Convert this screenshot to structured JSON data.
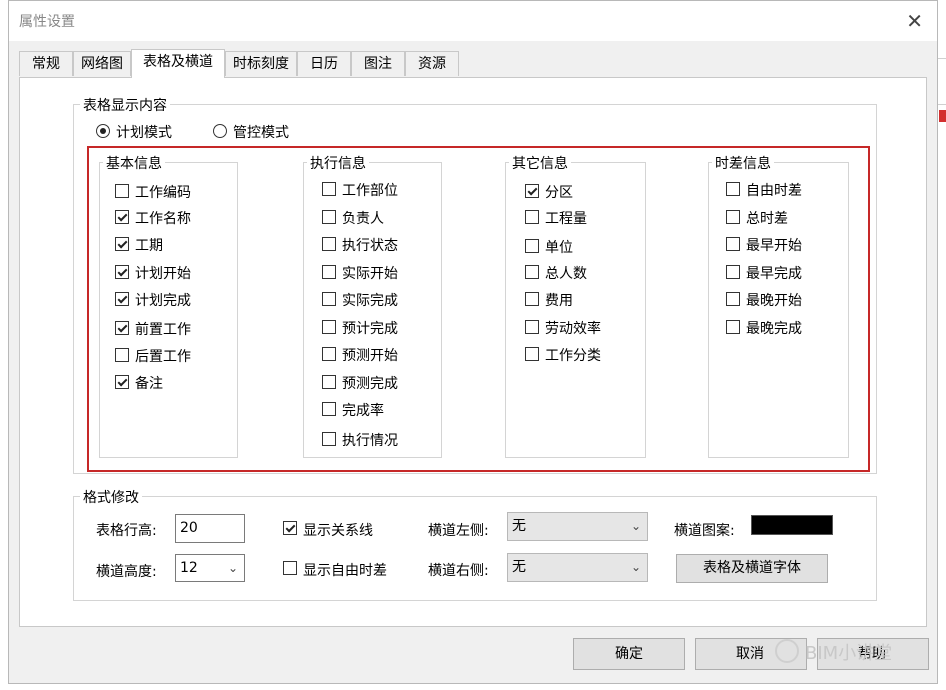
{
  "window": {
    "title": "属性设置",
    "close_symbol": "✕"
  },
  "tabs": [
    {
      "label": "常规"
    },
    {
      "label": "网络图"
    },
    {
      "label": "表格及横道"
    },
    {
      "label": "时标刻度"
    },
    {
      "label": "日历"
    },
    {
      "label": "图注"
    },
    {
      "label": "资源"
    }
  ],
  "table_display": {
    "title": "表格显示内容",
    "modes": [
      {
        "label": "计划模式",
        "selected": true
      },
      {
        "label": "管控模式",
        "selected": false
      }
    ],
    "groups": [
      {
        "title": "基本信息",
        "items": [
          {
            "label": "工作编码",
            "checked": false
          },
          {
            "label": "工作名称",
            "checked": true
          },
          {
            "label": "工期",
            "checked": true
          },
          {
            "label": "计划开始",
            "checked": true
          },
          {
            "label": "计划完成",
            "checked": true
          },
          {
            "label": "前置工作",
            "checked": true
          },
          {
            "label": "后置工作",
            "checked": false
          },
          {
            "label": "备注",
            "checked": true
          }
        ]
      },
      {
        "title": "执行信息",
        "items": [
          {
            "label": "工作部位",
            "checked": false
          },
          {
            "label": "负责人",
            "checked": false
          },
          {
            "label": "执行状态",
            "checked": false
          },
          {
            "label": "实际开始",
            "checked": false
          },
          {
            "label": "实际完成",
            "checked": false
          },
          {
            "label": "预计完成",
            "checked": false
          },
          {
            "label": "预测开始",
            "checked": false
          },
          {
            "label": "预测完成",
            "checked": false
          },
          {
            "label": "完成率",
            "checked": false
          },
          {
            "label": "执行情况",
            "checked": false
          }
        ]
      },
      {
        "title": "其它信息",
        "items": [
          {
            "label": "分区",
            "checked": true
          },
          {
            "label": "工程量",
            "checked": false
          },
          {
            "label": "单位",
            "checked": false
          },
          {
            "label": "总人数",
            "checked": false
          },
          {
            "label": "费用",
            "checked": false
          },
          {
            "label": "劳动效率",
            "checked": false
          },
          {
            "label": "工作分类",
            "checked": false
          }
        ]
      },
      {
        "title": "时差信息",
        "items": [
          {
            "label": "自由时差",
            "checked": false
          },
          {
            "label": "总时差",
            "checked": false
          },
          {
            "label": "最早开始",
            "checked": false
          },
          {
            "label": "最早完成",
            "checked": false
          },
          {
            "label": "最晚开始",
            "checked": false
          },
          {
            "label": "最晚完成",
            "checked": false
          }
        ]
      }
    ]
  },
  "format": {
    "title": "格式修改",
    "row_height_label": "表格行高:",
    "row_height_value": "20",
    "bar_height_label": "横道高度:",
    "bar_height_value": "12",
    "show_relation_label": "显示关系线",
    "show_relation_checked": true,
    "show_free_float_label": "显示自由时差",
    "show_free_float_checked": false,
    "bar_left_label": "横道左侧:",
    "bar_left_value": "无",
    "bar_right_label": "横道右侧:",
    "bar_right_value": "无",
    "bar_pattern_label": "横道图案:",
    "bar_pattern_color": "#000000",
    "font_button": "表格及横道字体"
  },
  "buttons": {
    "ok": "确定",
    "cancel": "取消",
    "help": "帮助"
  },
  "watermark": "BIM小讲堂",
  "colors": {
    "highlight_box": "#c62828"
  }
}
